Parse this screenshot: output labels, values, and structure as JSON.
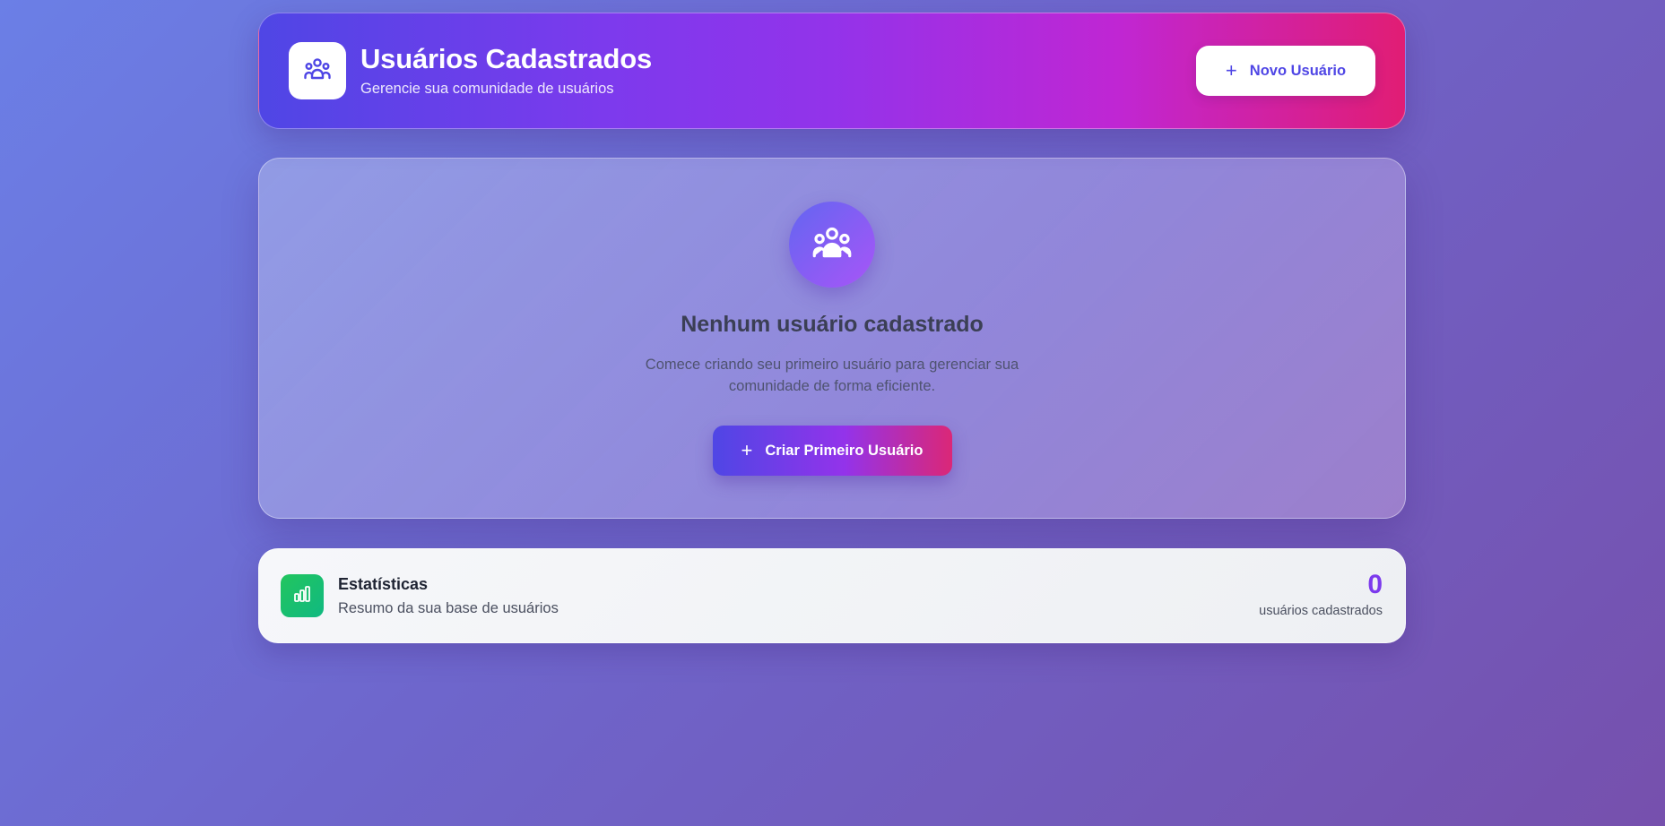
{
  "header": {
    "title": "Usuários Cadastrados",
    "subtitle": "Gerencie sua comunidade de usuários",
    "logo_icon": "users-icon",
    "new_user_button": {
      "icon": "plus-icon",
      "label": "Novo Usuário"
    }
  },
  "empty_state": {
    "icon": "users-icon",
    "title": "Nenhum usuário cadastrado",
    "description": "Comece criando seu primeiro usuário para gerenciar sua comunidade de forma eficiente.",
    "create_button": {
      "icon": "plus-icon",
      "label": "Criar Primeiro Usuário"
    }
  },
  "stats": {
    "icon": "bar-chart-icon",
    "title": "Estatísticas",
    "subtitle": "Resumo da sua base de usuários",
    "count": "0",
    "count_label": "usuários cadastrados"
  },
  "colors": {
    "accent_indigo": "#4f46e5",
    "accent_purple": "#9333ea",
    "accent_pink": "#db2777",
    "stats_green": "#22c55e",
    "count_color": "#7c3aed"
  }
}
